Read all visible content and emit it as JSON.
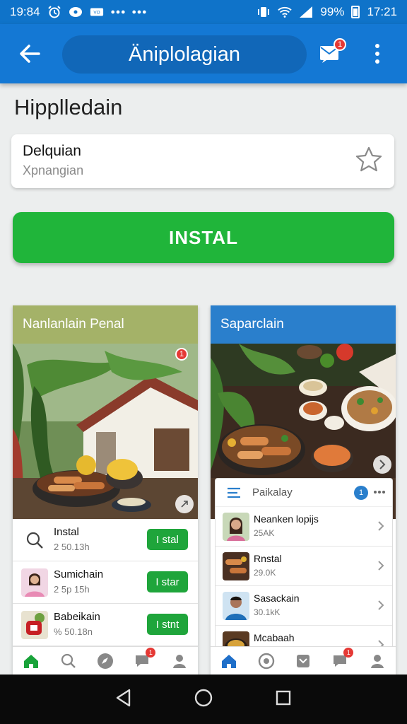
{
  "status_bar": {
    "time_left": "19:84",
    "battery_text": "99%",
    "time_right": "17:21",
    "icons_left": [
      "alarm-icon",
      "chat-bubble-icon",
      "video-icon",
      "more-dots-icon",
      "more-dots-icon"
    ],
    "icons_right": [
      "vibrate-icon",
      "wifi-icon",
      "signal-icon",
      "battery-icon"
    ]
  },
  "app_bar": {
    "title": "Äniplolagian",
    "mail_badge": "1",
    "color": "#1478d4"
  },
  "header": {
    "page_title": "Hipplledain",
    "card_title": "Delquian",
    "card_subtitle": "Xpnangian"
  },
  "install_button": {
    "label": "INSTAL",
    "color": "#20b53a"
  },
  "left_panel": {
    "title": "Nanlanlain Penal",
    "photo_badge": "1",
    "rows": [
      {
        "title": "Instal",
        "sub": "2 50.13h",
        "button": "I stal",
        "thumb": "search-icon"
      },
      {
        "title": "Sumichain",
        "sub": "2 5p 15h",
        "button": "I star",
        "thumb": "avatar"
      },
      {
        "title": "Babeikain",
        "sub": "% 50.18n",
        "button": "I stnt",
        "thumb": "app-icon"
      }
    ],
    "nav_badge": "1"
  },
  "right_panel": {
    "title": "Saparclain",
    "sub_card_title": "Paikalay",
    "sub_card_badge": "1",
    "rows": [
      {
        "title": "Neanken lopijs",
        "sub": "25AK"
      },
      {
        "title": "Rnstal",
        "sub": "29.0K"
      },
      {
        "title": "Sasackain",
        "sub": "30.1kK"
      },
      {
        "title": "Mcabaah"
      }
    ],
    "nav_badge": "1"
  }
}
